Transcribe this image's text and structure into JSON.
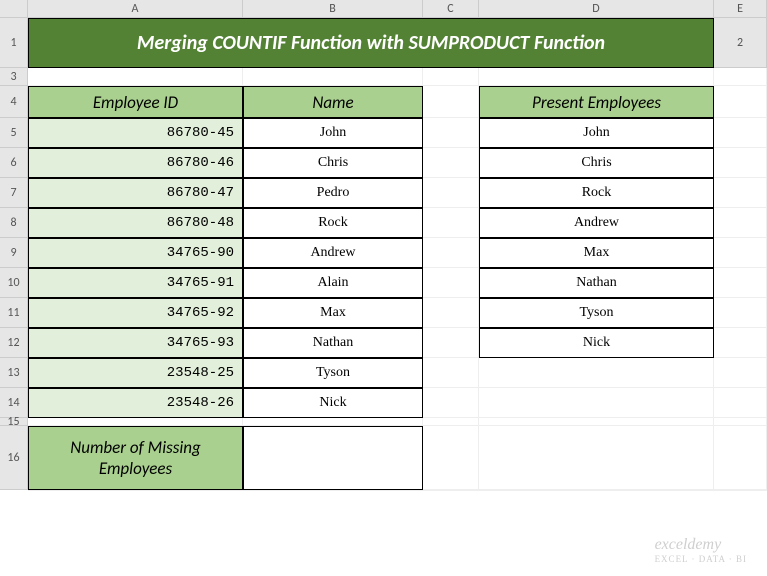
{
  "columns": [
    "A",
    "B",
    "C",
    "D",
    "E"
  ],
  "rows": [
    "1",
    "2",
    "3",
    "4",
    "5",
    "6",
    "7",
    "8",
    "9",
    "10",
    "11",
    "12",
    "13",
    "14",
    "15",
    "16"
  ],
  "title": "Merging COUNTIF Function with SUMPRODUCT Function",
  "headers": {
    "employee_id": "Employee ID",
    "name": "Name",
    "present": "Present Employees"
  },
  "employees": [
    {
      "id": "86780-45",
      "name": "John"
    },
    {
      "id": "86780-46",
      "name": "Chris"
    },
    {
      "id": "86780-47",
      "name": "Pedro"
    },
    {
      "id": "86780-48",
      "name": "Rock"
    },
    {
      "id": "34765-90",
      "name": "Andrew"
    },
    {
      "id": "34765-91",
      "name": "Alain"
    },
    {
      "id": "34765-92",
      "name": "Max"
    },
    {
      "id": "34765-93",
      "name": "Nathan"
    },
    {
      "id": "23548-25",
      "name": "Tyson"
    },
    {
      "id": "23548-26",
      "name": "Nick"
    }
  ],
  "present": [
    "John",
    "Chris",
    "Rock",
    "Andrew",
    "Max",
    "Nathan",
    "Tyson",
    "Nick"
  ],
  "missing_label": "Number of Missing Employees",
  "missing_value": "",
  "watermark": {
    "brand": "exceldemy",
    "sub": "EXCEL · DATA · BI"
  }
}
